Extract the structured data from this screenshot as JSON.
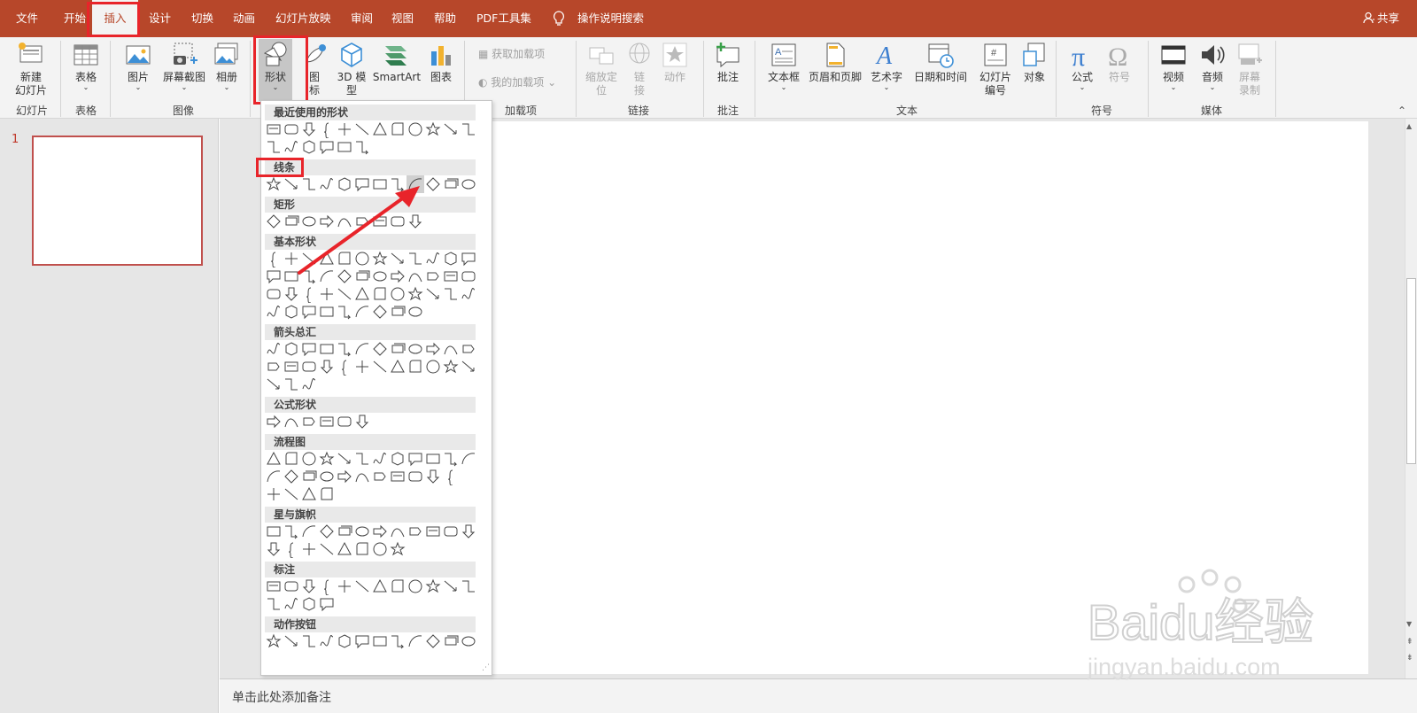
{
  "menu": {
    "tabs": [
      "文件",
      "开始",
      "插入",
      "设计",
      "切换",
      "动画",
      "幻灯片放映",
      "审阅",
      "视图",
      "帮助",
      "PDF工具集"
    ],
    "active": "插入",
    "tell_me": "操作说明搜索",
    "share": "共享"
  },
  "ribbon": {
    "new_slide": "新建\n幻灯片",
    "group_slides": "幻灯片",
    "table": "表格",
    "group_table": "表格",
    "picture": "图片",
    "screenshot": "屏幕截图",
    "album": "相册",
    "group_images": "图像",
    "shapes": "形状",
    "icons": "图\n标",
    "model3d": "3D 模\n型",
    "smartart": "SmartArt",
    "chart": "图表",
    "get_addins": "获取加载项",
    "my_addins": "我的加载项",
    "group_addins": "加载项",
    "zoom": "缩放定\n位",
    "link": "链\n接",
    "action": "动作",
    "group_links": "链接",
    "comment": "批注",
    "group_comments": "批注",
    "textbox": "文本框",
    "header_footer": "页眉和页脚",
    "wordart": "艺术字",
    "datetime": "日期和时间",
    "slide_number": "幻灯片\n编号",
    "object": "对象",
    "group_text": "文本",
    "equation": "公式",
    "symbol": "符号",
    "group_symbols": "符号",
    "video": "视频",
    "audio": "音频",
    "screen_record": "屏幕\n录制",
    "group_media": "媒体"
  },
  "gallery": {
    "sections": [
      "最近使用的形状",
      "线条",
      "矩形",
      "基本形状",
      "箭头总汇",
      "公式形状",
      "流程图",
      "星与旗帜",
      "标注",
      "动作按钮"
    ]
  },
  "slide_panel": {
    "slide_number": "1"
  },
  "notes": {
    "placeholder": "单击此处添加备注"
  },
  "watermark": {
    "brand": "Baidu经验",
    "url": "jingyan.baidu.com"
  },
  "colors": {
    "accent": "#b7472a",
    "highlight": "#e8242a"
  }
}
